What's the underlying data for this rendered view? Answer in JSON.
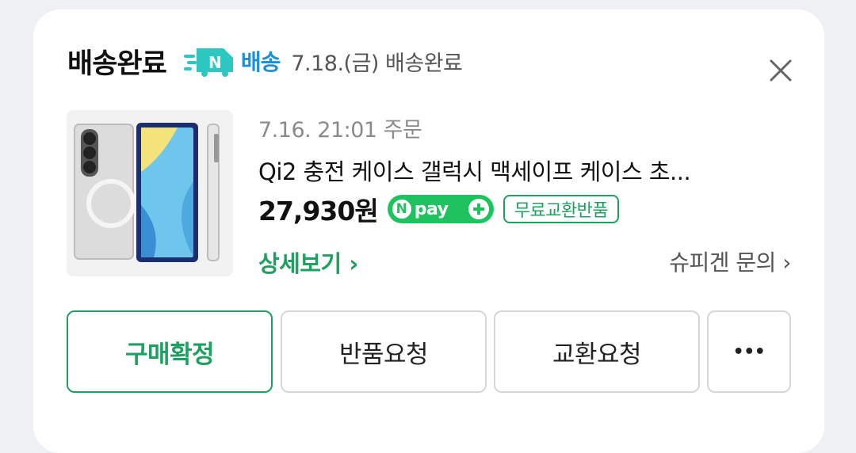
{
  "header": {
    "status": "배송완료",
    "delivery_badge": "배송",
    "delivery_info": "7.18.(금) 배송완료"
  },
  "order": {
    "date": "7.16. 21:01 주문",
    "product_name": "Qi2 충전 케이스 갤럭시 맥세이프 케이스 초...",
    "price": "27,930원",
    "npay_label": "pay",
    "free_exchange": "무료교환반품"
  },
  "links": {
    "detail": "상세보기 ›",
    "inquiry": "슈피겐 문의 ›"
  },
  "buttons": {
    "confirm": "구매확정",
    "return": "반품요청",
    "exchange": "교환요청",
    "more": "•••"
  },
  "colors": {
    "accent_green": "#1ea060",
    "npay_green": "#1ec35f",
    "delivery_blue": "#1b8fd8"
  }
}
